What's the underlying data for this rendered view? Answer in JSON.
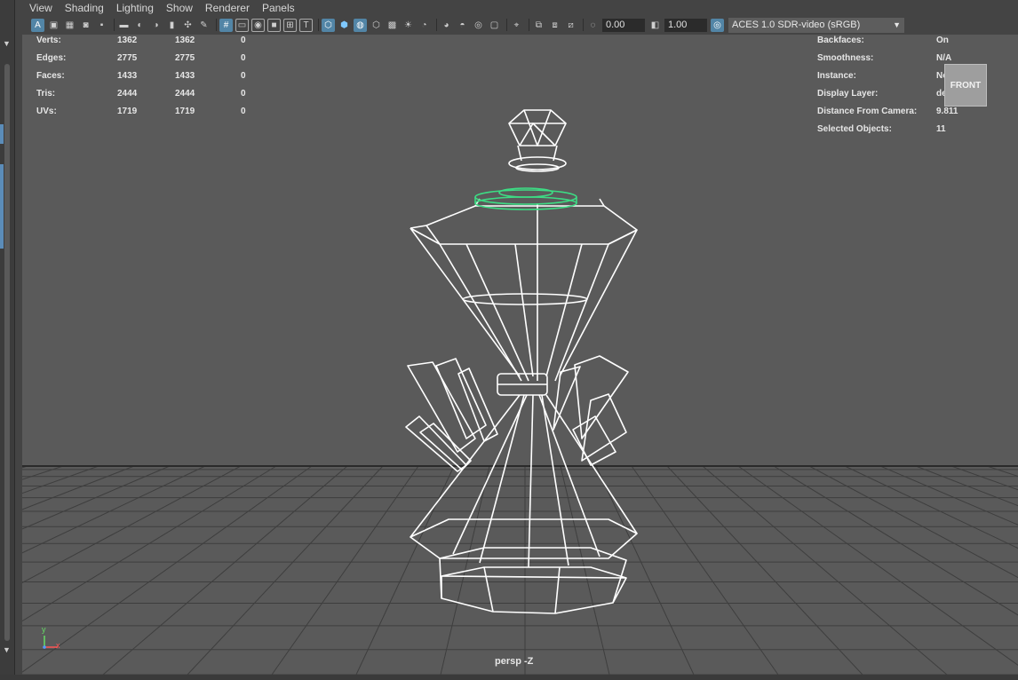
{
  "menubar": {
    "items": [
      "View",
      "Shading",
      "Lighting",
      "Show",
      "Renderer",
      "Panels"
    ]
  },
  "toolbar": {
    "icons": [
      "select-camera-icon",
      "camera-attributes-icon",
      "bookmark-icon",
      "image-plane-icon",
      "grid-toggle-icon",
      "film-gate-icon",
      "resolution-gate-icon",
      "gate-mask-icon",
      "field-chart-icon",
      "safe-action-icon",
      "safe-title-icon",
      "wireframe-icon",
      "smooth-shade-icon",
      "wireframe-on-shaded-icon",
      "default-material-icon",
      "xray-icon",
      "use-lights-icon",
      "shadows-icon",
      "screen-space-ao-icon",
      "motion-blur-icon",
      "multisample-aa-icon",
      "depth-of-field-icon",
      "isolate-select-icon",
      "xray-joints-icon",
      "xray-active-icon",
      "backface-culling-icon"
    ],
    "exposure_value": "0.00",
    "gamma_value": "1.00",
    "color_management": "ACES 1.0 SDR-video (sRGB)"
  },
  "hud_left": {
    "rows": [
      {
        "label": "Verts:",
        "a": "1362",
        "b": "1362",
        "c": "0"
      },
      {
        "label": "Edges:",
        "a": "2775",
        "b": "2775",
        "c": "0"
      },
      {
        "label": "Faces:",
        "a": "1433",
        "b": "1433",
        "c": "0"
      },
      {
        "label": "Tris:",
        "a": "2444",
        "b": "2444",
        "c": "0"
      },
      {
        "label": "UVs:",
        "a": "1719",
        "b": "1719",
        "c": "0"
      }
    ]
  },
  "hud_right": {
    "rows": [
      {
        "label": "Backfaces:",
        "value": "On"
      },
      {
        "label": "Smoothness:",
        "value": "N/A"
      },
      {
        "label": "Instance:",
        "value": "No"
      },
      {
        "label": "Display Layer:",
        "value": "default"
      },
      {
        "label": "Distance From Camera:",
        "value": "9.811"
      },
      {
        "label": "Selected Objects:",
        "value": "11"
      }
    ]
  },
  "viewcube": {
    "label": "FRONT"
  },
  "camera_label": "persp -Z",
  "axis": {
    "y": "y",
    "x": "x"
  },
  "colors": {
    "viewport_bg": "#5a5a5a",
    "wireframe": "#ffffff",
    "selection_highlight": "#3ddc84",
    "active_button": "#5285a6"
  }
}
